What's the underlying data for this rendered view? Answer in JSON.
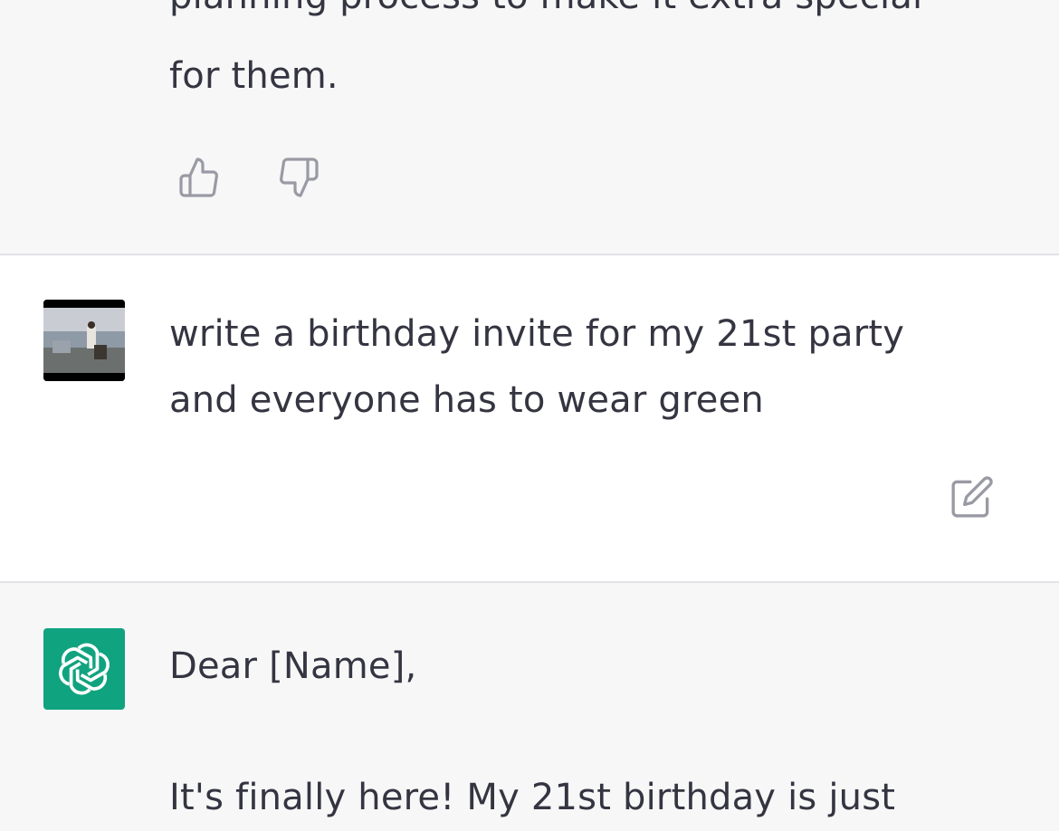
{
  "previous_response": {
    "line_partial": "planning process to make it extra special",
    "line_last": "for them."
  },
  "user_message": {
    "text": "write a birthday invite for my 21st party and everyone has to wear green"
  },
  "assistant_message": {
    "greeting": "Dear [Name],",
    "line_partial": "It's finally here! My 21st birthday is just"
  },
  "icons": {
    "thumbs_up": "thumbs-up-icon",
    "thumbs_down": "thumbs-down-icon",
    "edit": "edit-icon",
    "assistant_logo": "openai-logo-icon"
  },
  "colors": {
    "assistant_avatar_bg": "#10a37f",
    "text": "#343541",
    "icon": "#9a9aa4"
  }
}
